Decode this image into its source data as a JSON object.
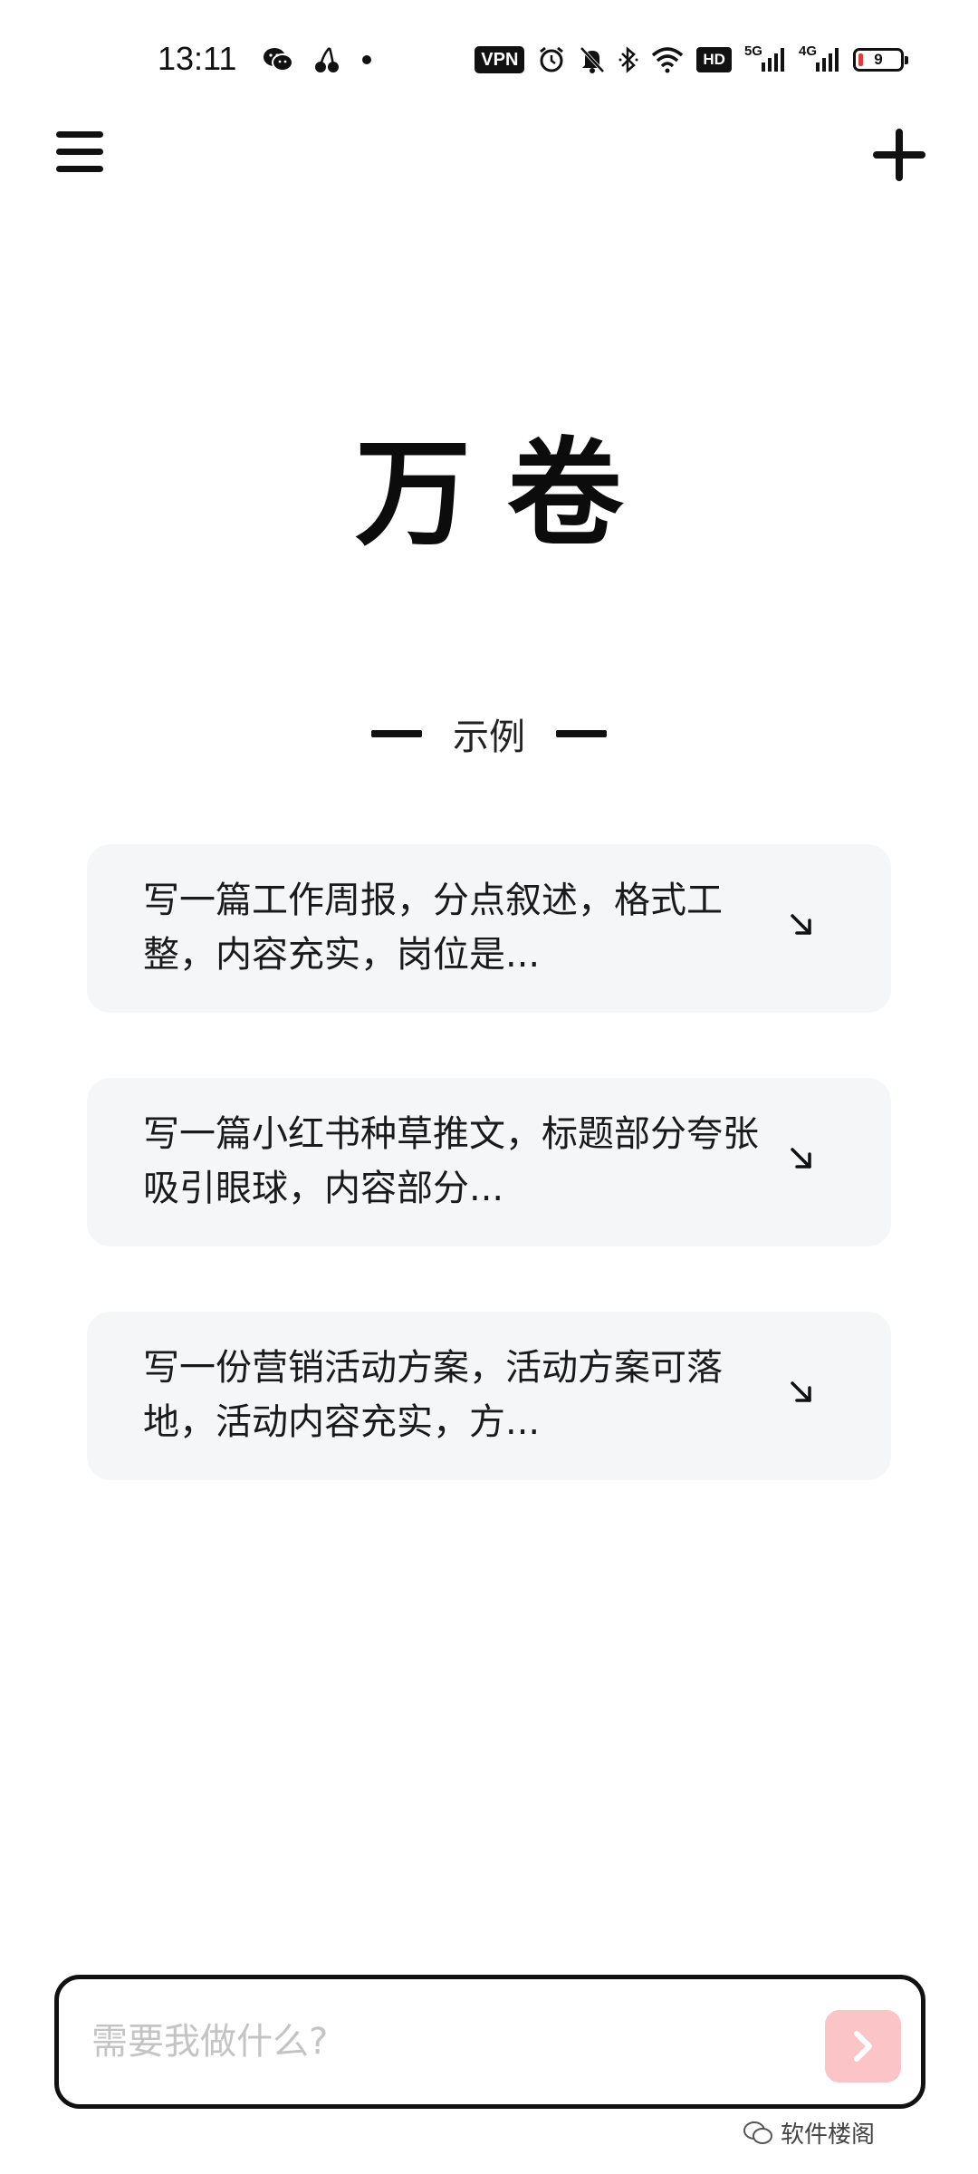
{
  "status_bar": {
    "time": "13:11",
    "vpn_label": "VPN",
    "hd_label": "HD",
    "net_5g_label": "5G",
    "net_4g_label": "4G",
    "battery_level": "9",
    "icons": [
      "wechat-icon",
      "cherry-icon",
      "dot-icon",
      "vpn-icon",
      "alarm-icon",
      "mute-icon",
      "bluetooth-icon",
      "wifi-icon",
      "hd-icon",
      "signal-5g-icon",
      "signal-4g-icon",
      "battery-icon"
    ]
  },
  "toolbar": {
    "menu_icon": "menu-icon",
    "add_icon": "plus-icon"
  },
  "app": {
    "title": "万卷"
  },
  "examples": {
    "heading": "示例",
    "items": [
      {
        "text": "写一篇工作周报，分点叙述，格式工整，内容充实，岗位是...",
        "icon": "arrow-down-right-icon"
      },
      {
        "text": "写一篇小红书种草推文，标题部分夸张吸引眼球，内容部分...",
        "icon": "arrow-down-right-icon"
      },
      {
        "text": "写一份营销活动方案，活动方案可落地，活动内容充实，方...",
        "icon": "arrow-down-right-icon"
      }
    ]
  },
  "input": {
    "placeholder": "需要我做什么?",
    "value": "",
    "send_icon": "chevron-right-icon"
  },
  "colors": {
    "card_bg": "#f5f6f8",
    "send_button_bg": "#fbc4c6",
    "battery_low": "#e23b3b"
  },
  "watermark": {
    "text": "软件楼阁"
  }
}
